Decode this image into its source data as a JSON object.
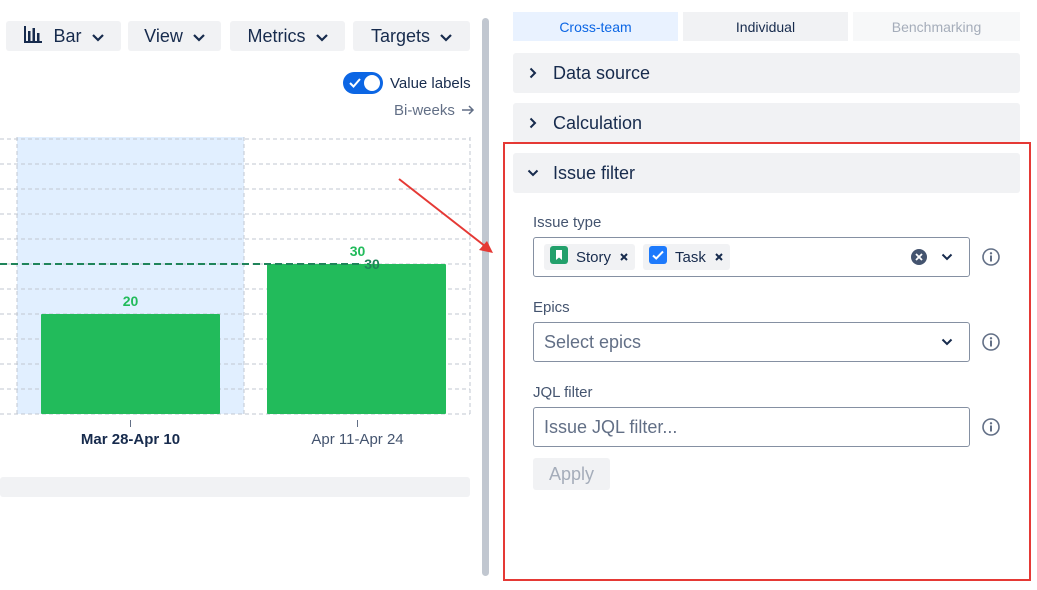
{
  "toolbar": {
    "chart_type": "Bar",
    "view": "View",
    "metrics": "Metrics",
    "targets": "Targets"
  },
  "chart_controls": {
    "value_labels": "Value labels",
    "value_labels_on": true,
    "period": "Bi-weeks"
  },
  "chart_data": {
    "type": "bar",
    "categories": [
      "Mar 28-Apr 10",
      "Apr 11-Apr 24"
    ],
    "values": [
      20,
      30
    ],
    "value_labels": [
      "20",
      "30"
    ],
    "target_value": 30,
    "target_label": "30",
    "highlighted_category": "Mar 28-Apr 10",
    "grid": true,
    "bar_color": "#22bb5b",
    "target_color": "#1f845a",
    "highlight_color": "#e1efff"
  },
  "segments": [
    "Cross-team",
    "Individual",
    "Benchmarking"
  ],
  "sections": {
    "data_source": "Data source",
    "calculation": "Calculation",
    "issue_filter": "Issue filter"
  },
  "issue_filter": {
    "issue_type_label": "Issue type",
    "issue_types": [
      "Story",
      "Task"
    ],
    "epics_label": "Epics",
    "epics_placeholder": "Select epics",
    "jql_label": "JQL filter",
    "jql_placeholder": "Issue JQL filter...",
    "apply": "Apply"
  },
  "colors": {
    "accent": "#0c66e4",
    "highlight_box": "#e53935"
  }
}
